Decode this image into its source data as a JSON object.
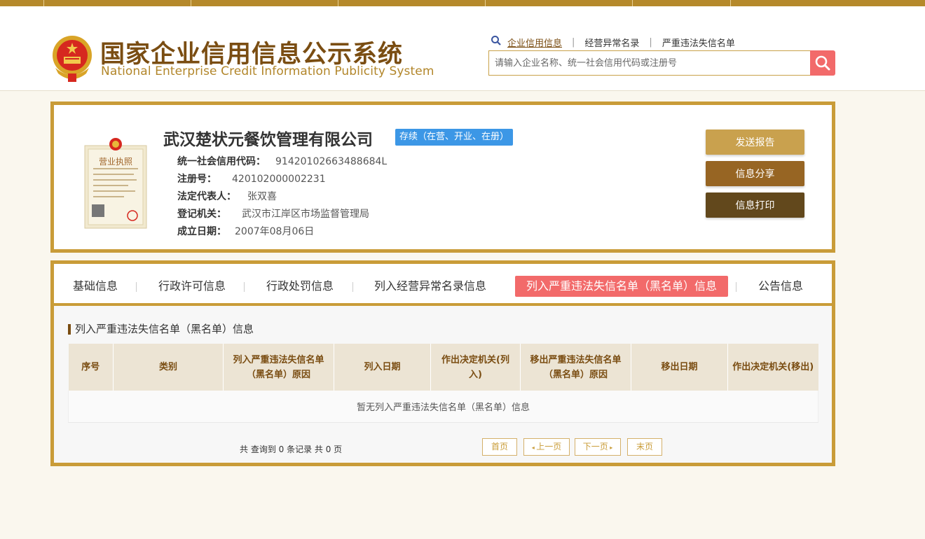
{
  "header": {
    "title": "国家企业信用信息公示系统",
    "subtitle": "National Enterprise Credit Information Publicity System",
    "search_links": [
      {
        "label": "企业信用信息"
      },
      {
        "label": "经营异常名录"
      },
      {
        "label": "严重违法失信名单"
      }
    ],
    "search_placeholder": "请输入企业名称、统一社会信用代码或注册号"
  },
  "company": {
    "name": "武汉楚状元餐饮管理有限公司",
    "status": "存续（在营、开业、在册）",
    "fields": [
      {
        "label": "统一社会信用代码：",
        "value": "91420102663488684L"
      },
      {
        "label": "注册号：",
        "value": "420102000002231"
      },
      {
        "label": "法定代表人：",
        "value": "张双喜"
      },
      {
        "label": "登记机关：",
        "value": "武汉市江岸区市场监督管理局"
      },
      {
        "label": "成立日期：",
        "value": "2007年08月06日"
      }
    ],
    "license_title": "营业执照"
  },
  "actions": {
    "send_report": "发送报告",
    "share": "信息分享",
    "print": "信息打印"
  },
  "tabs": [
    {
      "label": "基础信息"
    },
    {
      "label": "行政许可信息"
    },
    {
      "label": "行政处罚信息"
    },
    {
      "label": "列入经营异常名录信息"
    },
    {
      "label": "列入严重违法失信名单（黑名单）信息"
    },
    {
      "label": "公告信息"
    }
  ],
  "section": {
    "title": "列入严重违法失信名单（黑名单）信息",
    "columns": [
      "序号",
      "类别",
      "列入严重违法失信名单（黑名单）原因",
      "列入日期",
      "作出决定机关(列入)",
      "移出严重违法失信名单（黑名单）原因",
      "移出日期",
      "作出决定机关(移出)"
    ],
    "empty_text": "暂无列入严重违法失信名单（黑名单）信息"
  },
  "pagination": {
    "summary": "共 查询到 0 条记录 共 0 页",
    "first": "首页",
    "prev": "上一页",
    "next": "下一页",
    "last": "末页"
  },
  "colors": {
    "gold": "#c99c38",
    "brown": "#7a4d12",
    "red": "#f26a6a",
    "blue": "#3c97e6",
    "btn_send": "#c9a14e",
    "btn_share": "#976523",
    "btn_print": "#62481c"
  }
}
